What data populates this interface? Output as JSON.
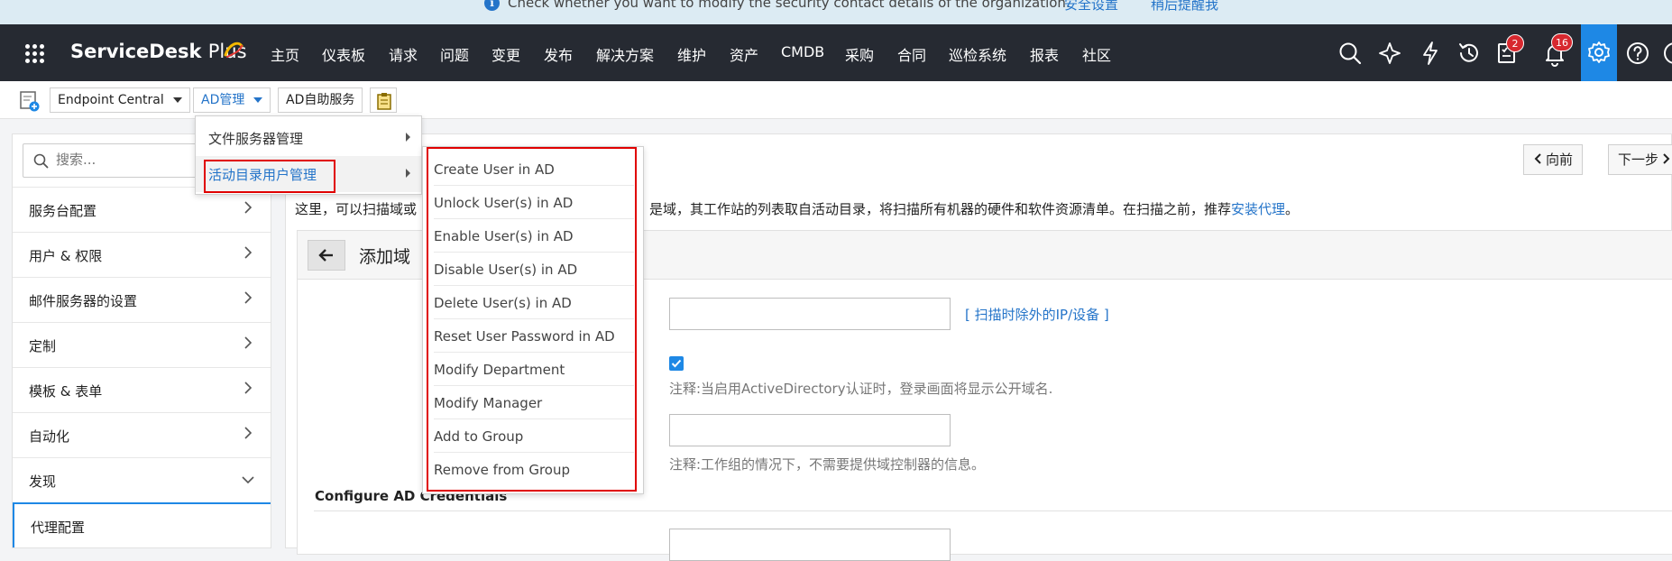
{
  "banner": {
    "message": "Check whether you want to modify the security contact details of the organization.",
    "link_security": "安全设置",
    "link_remind": "稍后提醒我"
  },
  "topnav": {
    "brand": "ServiceDesk",
    "brand_suffix": "Plus",
    "items": [
      "主页",
      "仪表板",
      "请求",
      "问题",
      "变更",
      "发布",
      "解决方案",
      "维护",
      "资产",
      "CMDB",
      "采购",
      "合同",
      "巡检系统",
      "报表",
      "社区"
    ],
    "icons": [
      "search-icon",
      "spark-icon",
      "lightning-icon",
      "history-icon",
      "tasks-icon",
      "bell-icon",
      "gear-icon",
      "help-icon"
    ],
    "badge_tasks": "2",
    "badge_notifications": "16",
    "accent": "#1e88e5"
  },
  "toolbar": {
    "product_select": "Endpoint Central",
    "ad_menu": "AD管理",
    "ad_selfservice": "AD自助服务"
  },
  "sidebar": {
    "search_placeholder": "搜索...",
    "items": [
      {
        "label": "服务台配置"
      },
      {
        "label": "用户 & 权限"
      },
      {
        "label": "邮件服务器的设置"
      },
      {
        "label": "定制"
      },
      {
        "label": "模板 & 表单"
      },
      {
        "label": "自动化"
      },
      {
        "label": "发现"
      },
      {
        "label": "代理配置"
      }
    ]
  },
  "main": {
    "prev_label": "向前",
    "next_label": "下一步",
    "desc_start": "这里，可以扫描域或",
    "desc_end": "是域，其工作站的列表取自活动目录，将扫描所有机器的硬件和软件资源清单。在扫描之前，推荐",
    "desc_link": "安装代理",
    "desc_period": "。",
    "form_title": "添加域",
    "exclude_link": "[ 扫描时除外的IP/设备 ]",
    "note_ad": "注释:当启用ActiveDirectory认证时，登录画面将显示公开域名.",
    "note_workgroup": "注释:工作组的情况下，不需要提供域控制器的信息。",
    "section_credentials": "Configure AD Credentials"
  },
  "menu_level1": {
    "items": [
      "文件服务器管理",
      "活动目录用户管理"
    ]
  },
  "menu_level2": {
    "items": [
      "Create User in AD",
      "Unlock User(s) in AD",
      "Enable User(s) in AD",
      "Disable User(s) in AD",
      "Delete User(s) in AD",
      "Reset User Password in AD",
      "Modify Department",
      "Modify Manager",
      "Add to Group",
      "Remove from Group"
    ]
  }
}
